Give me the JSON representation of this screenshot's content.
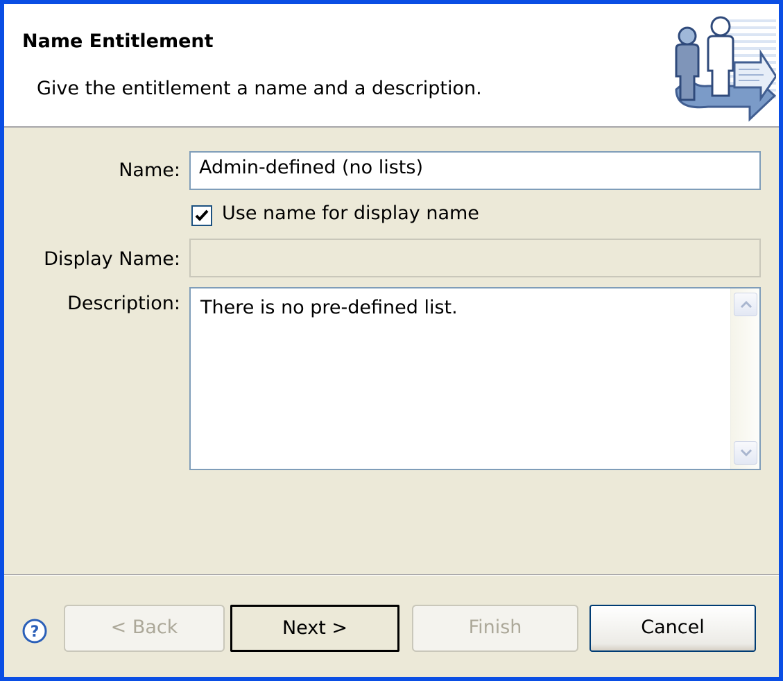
{
  "header": {
    "title": "Name Entitlement",
    "description": "Give the entitlement a name and a description."
  },
  "form": {
    "name_label": "Name:",
    "name_value": "Admin-defined (no lists)",
    "use_name_checked": true,
    "use_name_label": "Use name for display name",
    "display_name_label": "Display Name:",
    "display_name_value": "",
    "description_label": "Description:",
    "description_value": "There is no pre-defined list."
  },
  "buttons": {
    "back": "< Back",
    "next": "Next >",
    "finish": "Finish",
    "cancel": "Cancel"
  },
  "icons": {
    "help": "help-icon",
    "header_graphic": "users-entitlement-icon",
    "check": "check-icon",
    "scroll_up": "chevron-up-icon",
    "scroll_down": "chevron-down-icon"
  },
  "colors": {
    "window_border": "#0a4ee4",
    "dialog_bg": "#ece9d8",
    "field_border": "#7f9db9",
    "help_blue": "#2a5fb8"
  }
}
